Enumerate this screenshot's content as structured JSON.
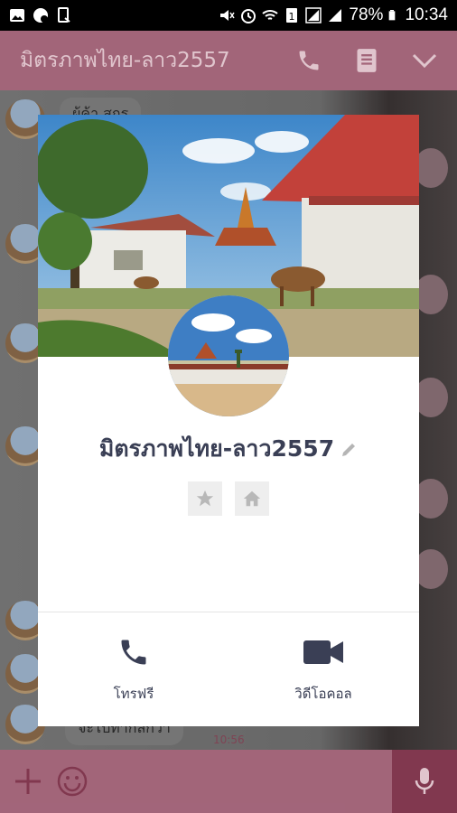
{
  "status_bar": {
    "battery": "78%",
    "time": "10:34"
  },
  "header": {
    "title": "มิตรภาพไทย-ลาว2557",
    "actions": [
      "phone-icon",
      "note-icon",
      "chevron-down-icon"
    ]
  },
  "background_chat": {
    "bubble_top": "ผู้ค้า สุกร",
    "bubble_bottom": "จะไปทำกัลกว่า",
    "time": "10:56"
  },
  "profile": {
    "name": "มิตรภาพไทย-ลาว2557",
    "free_call_label": "โทรฟรี",
    "video_call_label": "วิดีโอคอล"
  },
  "colors": {
    "header_bg": "#b06e84",
    "mic_bg": "#8c3d56",
    "icon_color": "#3a3f55"
  }
}
